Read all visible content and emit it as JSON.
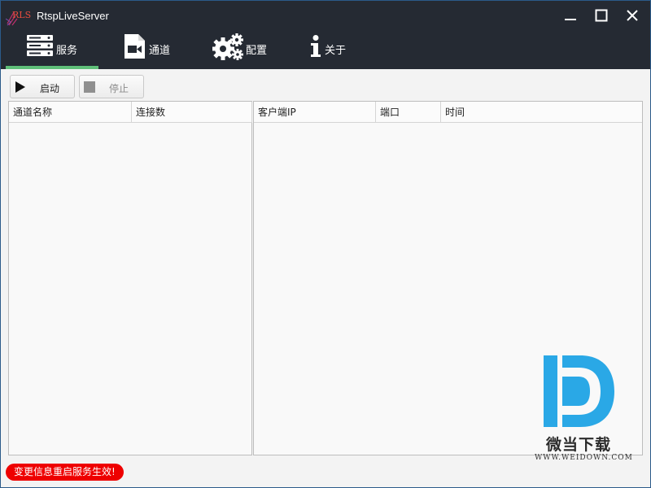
{
  "window": {
    "title": "RtspLiveServer",
    "logo_text": "RLS"
  },
  "colors": {
    "topbar_bg": "#252a33",
    "active_tab_accent": "#5fbf79",
    "status_badge": "#ee0000"
  },
  "nav": {
    "items": [
      {
        "label": "服务",
        "icon": "server-icon",
        "active": true
      },
      {
        "label": "通道",
        "icon": "video-camera-icon",
        "active": false
      },
      {
        "label": "配置",
        "icon": "gears-icon",
        "active": false
      },
      {
        "label": "关于",
        "icon": "info-icon",
        "active": false
      }
    ]
  },
  "toolbar": {
    "start_label": "启动",
    "stop_label": "停止"
  },
  "channels_table": {
    "columns": [
      "通道名称",
      "连接数"
    ],
    "rows": []
  },
  "clients_table": {
    "columns": [
      "客户端IP",
      "端口",
      "时间"
    ],
    "rows": []
  },
  "status": {
    "message": "变更信息重启服务生效!"
  },
  "watermark": {
    "text": "微当下载",
    "url": "WWW.WEIDOWN.COM"
  }
}
